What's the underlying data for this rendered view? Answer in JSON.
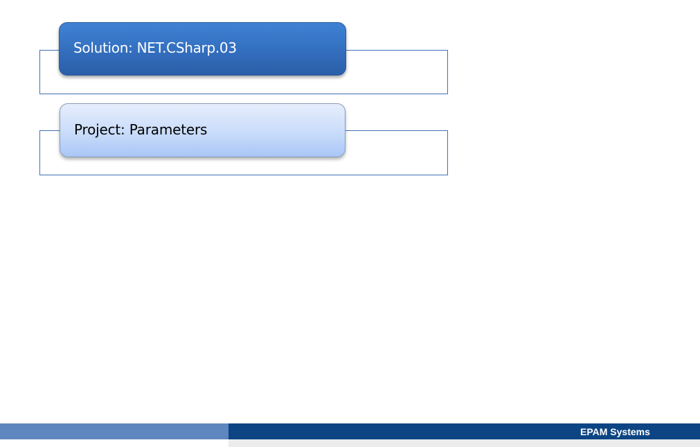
{
  "diagram": {
    "solution_label": "Solution: NET.CSharp.03",
    "project_label": "Project: Parameters"
  },
  "footer": {
    "brand": "EPAM Systems"
  },
  "colors": {
    "solution_fill": "#3470c0",
    "project_fill": "#c9dcfa",
    "frame_border": "#3f6fb5",
    "footer_dark": "#0d4584",
    "footer_light": "#5e87c0"
  }
}
